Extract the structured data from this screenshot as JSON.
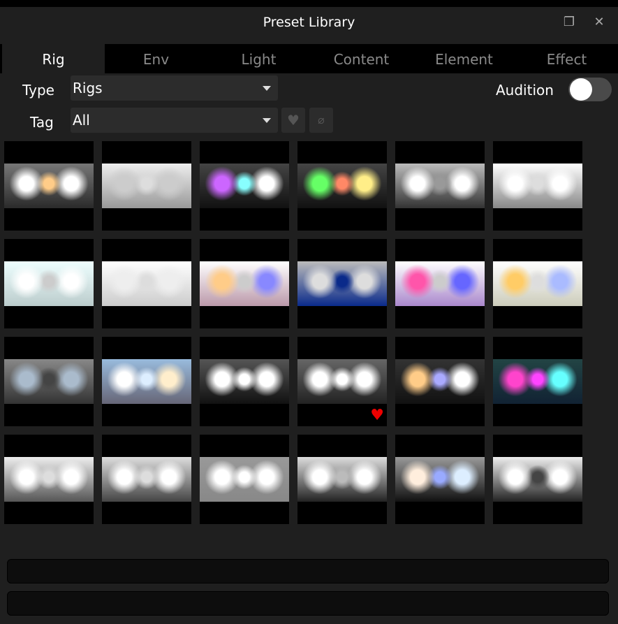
{
  "window": {
    "title": "Preset Library",
    "restore_icon": "restore-window-icon",
    "close_icon": "close-icon"
  },
  "tabs": [
    {
      "label": "Rig",
      "active": true
    },
    {
      "label": "Env"
    },
    {
      "label": "Light"
    },
    {
      "label": "Content"
    },
    {
      "label": "Element"
    },
    {
      "label": "Effect"
    }
  ],
  "filters": {
    "type_label": "Type",
    "type_value": "Rigs",
    "tag_label": "Tag",
    "tag_value": "All",
    "audition_label": "Audition",
    "audition_on": false
  },
  "tiles": [
    {
      "base": "#2a2a2a",
      "light": "#777",
      "blobs": [
        "#ffffff",
        "#ffcc88",
        "#ffffff"
      ]
    },
    {
      "base": "#999",
      "light": "#eee",
      "blobs": [
        "#ccc",
        "#ddd",
        "#ccc"
      ]
    },
    {
      "base": "#111",
      "light": "#444",
      "blobs": [
        "#cc66ff",
        "#88ffff",
        "#ffffff"
      ]
    },
    {
      "base": "#111",
      "light": "#444",
      "blobs": [
        "#66ff66",
        "#ff8866",
        "#ffee88"
      ]
    },
    {
      "base": "#333",
      "light": "#bbb",
      "blobs": [
        "#ffffff",
        "#999",
        "#ffffff"
      ]
    },
    {
      "base": "#888",
      "light": "#fff",
      "blobs": [
        "#ffffff",
        "#ddd",
        "#ffffff"
      ]
    },
    {
      "base": "#bcc",
      "light": "#eff",
      "blobs": [
        "#ffffff",
        "#ccc",
        "#ffffff"
      ]
    },
    {
      "base": "#ccc",
      "light": "#fff",
      "blobs": [
        "#eee",
        "#ddd",
        "#eee"
      ]
    },
    {
      "base": "#b9a",
      "light": "#fff",
      "blobs": [
        "#ffcc88",
        "#ccc",
        "#8888ff"
      ]
    },
    {
      "base": "#0a2a8a",
      "light": "#bbb",
      "blobs": [
        "#ddd",
        "#0a2a8a",
        "#ddd"
      ]
    },
    {
      "base": "#a8c",
      "light": "#fff",
      "blobs": [
        "#ff55aa",
        "#ccc",
        "#6666ff"
      ]
    },
    {
      "base": "#ccb",
      "light": "#fff",
      "blobs": [
        "#ffcc66",
        "#ddd",
        "#aabbff"
      ]
    },
    {
      "base": "#333",
      "light": "#888",
      "blobs": [
        "#aabbcc",
        "#444",
        "#aabbcc"
      ]
    },
    {
      "base": "#667",
      "light": "#9bd",
      "blobs": [
        "#ffffff",
        "#ddeeff",
        "#ffeecc"
      ]
    },
    {
      "base": "#111",
      "light": "#555",
      "blobs": [
        "#ffffff",
        "#ffffff",
        "#ffffff"
      ]
    },
    {
      "base": "#222",
      "light": "#666",
      "blobs": [
        "#ffffff",
        "#ffffff",
        "#ffffff"
      ],
      "favorite": true
    },
    {
      "base": "#111",
      "light": "#333",
      "blobs": [
        "#ffcc88",
        "#aaaaff",
        "#ffffff"
      ]
    },
    {
      "base": "#123",
      "light": "#244",
      "blobs": [
        "#ff44cc",
        "#ff44ff",
        "#66ffff"
      ]
    },
    {
      "base": "#555",
      "light": "#eee",
      "blobs": [
        "#ffffff",
        "#ddd",
        "#ffffff"
      ]
    },
    {
      "base": "#444",
      "light": "#ddd",
      "blobs": [
        "#ffffff",
        "#ddd",
        "#ffffff"
      ]
    },
    {
      "base": "#888",
      "light": "#999",
      "blobs": [
        "#ffffff",
        "#ffffff",
        "#ffffff"
      ]
    },
    {
      "base": "#222",
      "light": "#ddd",
      "blobs": [
        "#ffffff",
        "#bbb",
        "#ffffff"
      ]
    },
    {
      "base": "#111",
      "light": "#999",
      "blobs": [
        "#ffeedd",
        "#99aaff",
        "#ddeeff"
      ]
    },
    {
      "base": "#222",
      "light": "#eee",
      "blobs": [
        "#ffffff",
        "#444",
        "#ffffff"
      ]
    }
  ],
  "favorite_icon": "heart-icon",
  "colors": {
    "background": "#1f1f1f",
    "favorite": "#e00000"
  }
}
